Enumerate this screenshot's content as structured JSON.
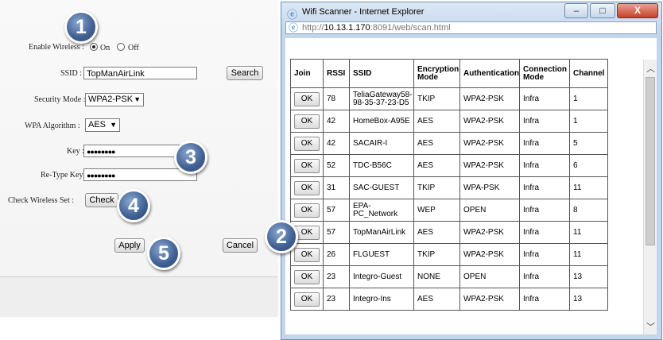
{
  "router": {
    "enable_wireless_label": "Enable Wireless :",
    "on_label": "On",
    "off_label": "Off",
    "ssid_label": "SSID :",
    "ssid_value": "TopManAirLink",
    "search_label": "Search",
    "security_mode_label": "Security Mode :",
    "security_mode_value": "WPA2-PSK",
    "wpa_algorithm_label": "WPA Algorithm :",
    "wpa_algorithm_value": "AES",
    "key_label": "Key :",
    "key_value": "●●●●●●●●",
    "retype_key_label": "Re-Type Key :",
    "retype_key_value": "●●●●●●●●",
    "check_wireless_label": "Check Wireless Set :",
    "check_label": "Check",
    "apply_label": "Apply",
    "cancel_label": "Cancel"
  },
  "callouts": [
    "1",
    "2",
    "3",
    "4",
    "5"
  ],
  "ie": {
    "title": "Wifi Scanner - Internet Explorer",
    "url_prefix": "http://",
    "url_host": "10.13.1.170",
    "url_rest": ":8091/web/scan.html",
    "minimize": "–",
    "maximize": "□",
    "close": "X"
  },
  "scan_table": {
    "headers": [
      "Join",
      "RSSI",
      "SSID",
      "Encryption Mode",
      "Authentication",
      "Connection Mode",
      "Channel"
    ],
    "ok_label": "OK",
    "rows": [
      {
        "rssi": "78",
        "ssid": "TeliaGateway58-98-35-37-23-D5",
        "enc": "TKIP",
        "auth": "WPA2-PSK",
        "conn": "Infra",
        "ch": "1"
      },
      {
        "rssi": "42",
        "ssid": "HomeBox-A95E",
        "enc": "AES",
        "auth": "WPA2-PSK",
        "conn": "Infra",
        "ch": "1"
      },
      {
        "rssi": "42",
        "ssid": "SACAIR-I",
        "enc": "AES",
        "auth": "WPA2-PSK",
        "conn": "Infra",
        "ch": "5"
      },
      {
        "rssi": "52",
        "ssid": "TDC-B56C",
        "enc": "AES",
        "auth": "WPA2-PSK",
        "conn": "Infra",
        "ch": "6"
      },
      {
        "rssi": "31",
        "ssid": "SAC-GUEST",
        "enc": "TKIP",
        "auth": "WPA-PSK",
        "conn": "Infra",
        "ch": "11"
      },
      {
        "rssi": "57",
        "ssid": "EPA-PC_Network",
        "enc": "WEP",
        "auth": "OPEN",
        "conn": "Infra",
        "ch": "8"
      },
      {
        "rssi": "57",
        "ssid": "TopManAirLink",
        "enc": "AES",
        "auth": "WPA2-PSK",
        "conn": "Infra",
        "ch": "11"
      },
      {
        "rssi": "26",
        "ssid": "FLGUEST",
        "enc": "TKIP",
        "auth": "WPA2-PSK",
        "conn": "Infra",
        "ch": "11"
      },
      {
        "rssi": "23",
        "ssid": "Integro-Guest",
        "enc": "NONE",
        "auth": "OPEN",
        "conn": "Infra",
        "ch": "13"
      },
      {
        "rssi": "23",
        "ssid": "Integro-Ins",
        "enc": "AES",
        "auth": "WPA2-PSK",
        "conn": "Infra",
        "ch": "13"
      }
    ]
  }
}
